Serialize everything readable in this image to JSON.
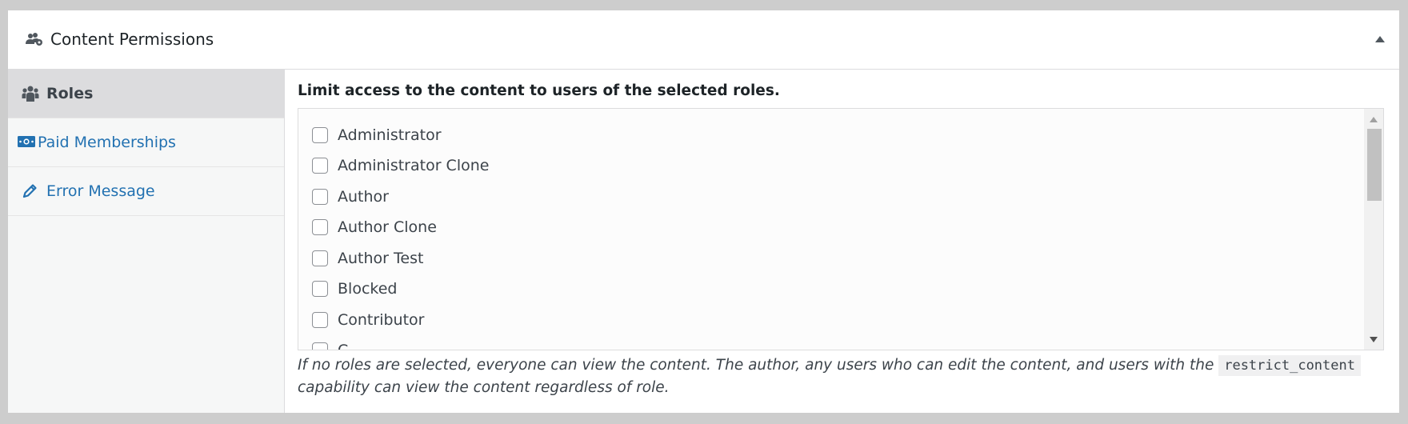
{
  "panel": {
    "title": "Content Permissions",
    "header_icon": "users-gear-icon",
    "collapse_icon": "triangle-up-icon"
  },
  "tabs": [
    {
      "label": "Roles",
      "icon": "users-icon",
      "active": true
    },
    {
      "label": "Paid Memberships",
      "icon": "money-icon",
      "active": false
    },
    {
      "label": "Error Message",
      "icon": "pencil-icon",
      "active": false
    }
  ],
  "roles_section": {
    "description": "Limit access to the content to users of the selected roles.",
    "roles": [
      {
        "label": "Administrator",
        "checked": false
      },
      {
        "label": "Administrator Clone",
        "checked": false
      },
      {
        "label": "Author",
        "checked": false
      },
      {
        "label": "Author Clone",
        "checked": false
      },
      {
        "label": "Author Test",
        "checked": false
      },
      {
        "label": "Blocked",
        "checked": false
      },
      {
        "label": "Contributor",
        "checked": false
      },
      {
        "label": "C...",
        "checked": false
      }
    ],
    "note_before": "If no roles are selected, everyone can view the content. The author, any users who can edit the content, and users with the",
    "note_code": "restrict_content",
    "note_after": "capability can view the content regardless of role."
  },
  "colors": {
    "link": "#2271b1",
    "active_tab_bg": "#dcdcde",
    "page_bg": "#cdcdcd"
  }
}
